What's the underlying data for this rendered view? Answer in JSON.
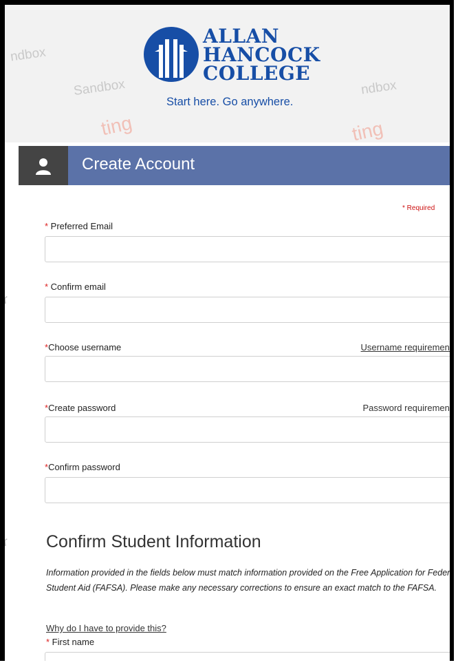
{
  "logo": {
    "line1": "ALLAN",
    "line2": "HANCOCK",
    "line3": "COLLEGE",
    "tagline": "Start here. Go anywhere."
  },
  "watermarks": {
    "sandbox_a": "ndbox",
    "sandbox_b": "Sandbox",
    "sandbox_c": "ndbox",
    "testing_a": "ting",
    "testing_b": "ting"
  },
  "header": {
    "title": "Create Account",
    "icon": "user-icon"
  },
  "form": {
    "required_note": "* Required",
    "fields": [
      {
        "label": "Preferred Email",
        "value": ""
      },
      {
        "label": "Confirm email",
        "value": ""
      },
      {
        "label": "Choose username",
        "value": "",
        "link": "Username requirements"
      },
      {
        "label": "Create password",
        "value": "",
        "hint": "Password requirements"
      },
      {
        "label": "Confirm password",
        "value": ""
      }
    ]
  },
  "student_info": {
    "title": "Confirm Student Information",
    "description": "Information provided in the fields below must match information provided on the Free Application for Federal Student Aid (FAFSA). Please make any necessary corrections to ensure an exact match to the FAFSA.",
    "why_link": "Why do I have to provide this?",
    "first_name_label": "First name"
  },
  "colors": {
    "brand_blue": "#174ea6",
    "header_bg": "#5b72a8",
    "required_red": "#d22222"
  }
}
